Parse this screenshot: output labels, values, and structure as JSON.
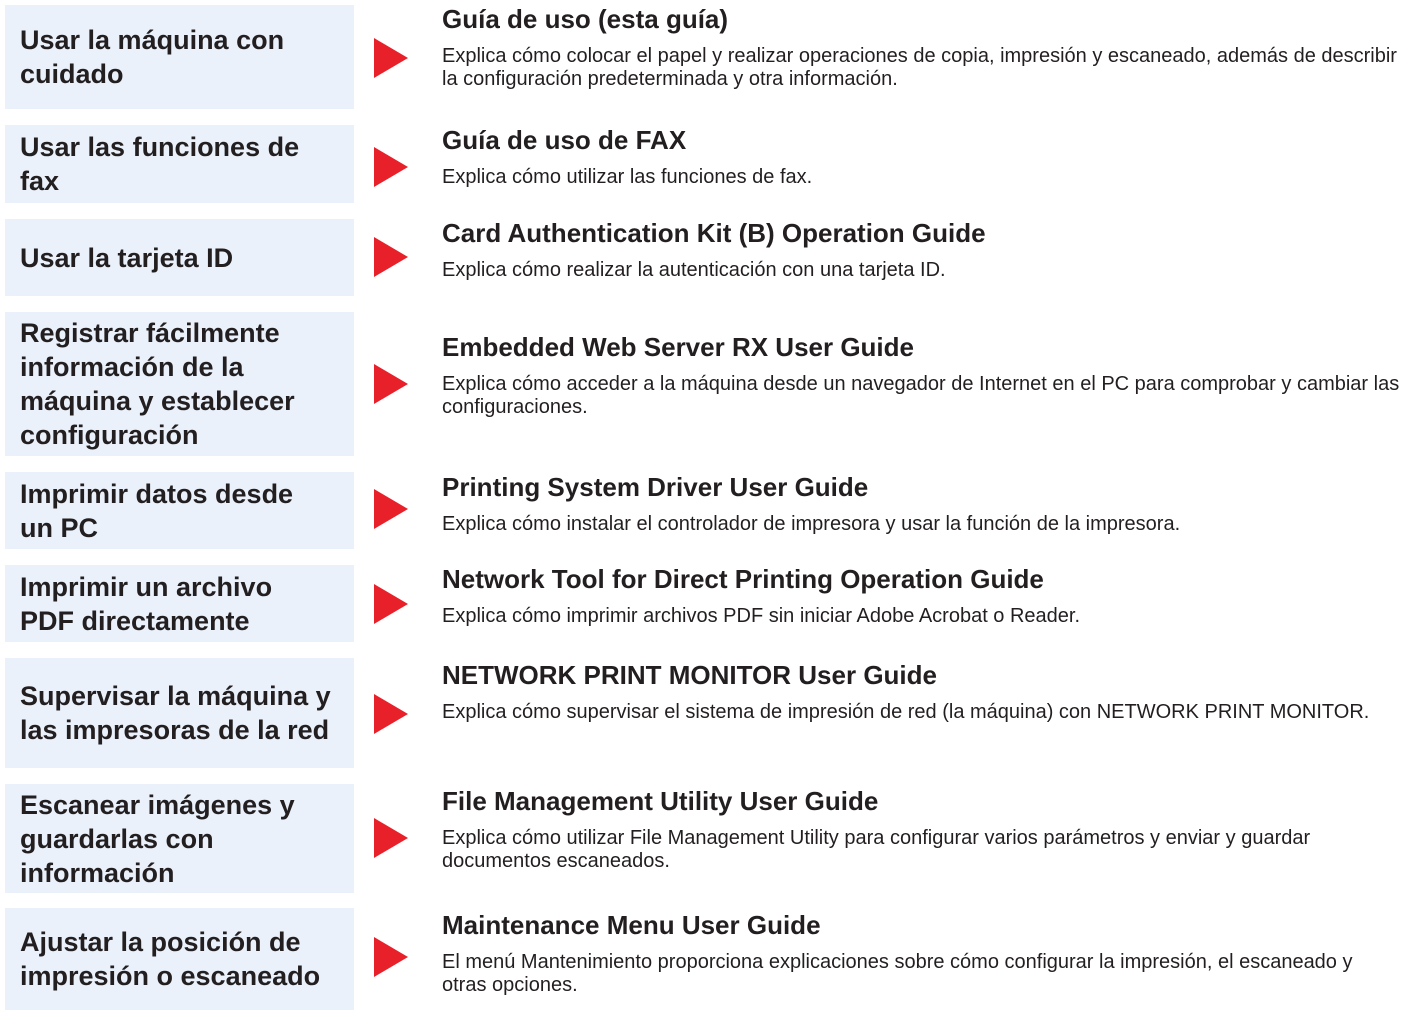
{
  "colors": {
    "task_box_background": "#eaf1fb",
    "arrow": "#e8202a",
    "text": "#231f20"
  },
  "rows": [
    {
      "task": "Usar la máquina con cuidado",
      "guide_title": "Guía de uso (esta guía)",
      "guide_description": "Explica cómo colocar el papel y realizar operaciones de copia, impresión y escaneado, además de describir la configuración predeterminada y otra información.",
      "arrow_icon": "right-triangle-icon"
    },
    {
      "task": "Usar las funciones de fax",
      "guide_title": "Guía de uso de FAX",
      "guide_description": "Explica cómo utilizar las funciones de fax.",
      "arrow_icon": "right-triangle-icon"
    },
    {
      "task": "Usar la tarjeta ID",
      "guide_title": "Card Authentication Kit (B) Operation Guide",
      "guide_description": "Explica cómo realizar la autenticación con una tarjeta ID.",
      "arrow_icon": "right-triangle-icon"
    },
    {
      "task": "Registrar fácilmente información de la máquina y establecer configuración",
      "guide_title": "Embedded Web Server RX User Guide",
      "guide_description": "Explica cómo acceder a la máquina desde un navegador de Internet en el PC para comprobar y cambiar las configuraciones.",
      "arrow_icon": "right-triangle-icon"
    },
    {
      "task": "Imprimir datos desde un PC",
      "guide_title": "Printing System Driver User Guide",
      "guide_description": "Explica cómo instalar el controlador de impresora y usar la función de la impresora.",
      "arrow_icon": "right-triangle-icon"
    },
    {
      "task": "Imprimir un archivo PDF directamente",
      "guide_title": "Network Tool for Direct Printing Operation Guide",
      "guide_description": "Explica cómo imprimir archivos PDF sin iniciar Adobe Acrobat o Reader.",
      "arrow_icon": "right-triangle-icon"
    },
    {
      "task": "Supervisar la máquina y las impresoras de la red",
      "guide_title": "NETWORK PRINT MONITOR User Guide",
      "guide_description": "Explica cómo supervisar el sistema de impresión de red (la máquina) con NETWORK PRINT MONITOR.",
      "arrow_icon": "right-triangle-icon"
    },
    {
      "task": "Escanear imágenes y guardarlas con información",
      "guide_title": "File Management Utility User Guide",
      "guide_description": "Explica cómo utilizar File Management Utility para configurar varios parámetros y enviar y guardar documentos escaneados.",
      "arrow_icon": "right-triangle-icon"
    },
    {
      "task": "Ajustar la posición de impresión o escaneado",
      "guide_title": "Maintenance Menu User Guide",
      "guide_description": "El menú Mantenimiento proporciona explicaciones sobre cómo configurar la impresión, el escaneado y otras opciones.",
      "arrow_icon": "right-triangle-icon"
    }
  ]
}
